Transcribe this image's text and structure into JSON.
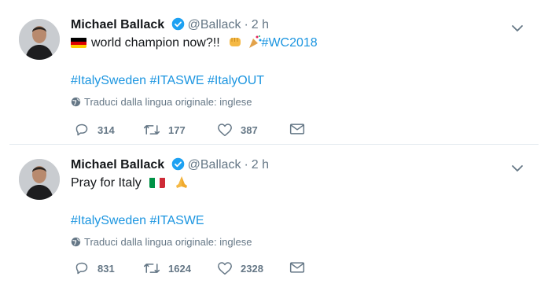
{
  "tweets": [
    {
      "name": "Michael Ballack",
      "handle": "@Ballack",
      "dot": "·",
      "time": "2 h",
      "text": "world champion now?!!",
      "tags": "#ItalySweden #ITASWE #ItalyOUT",
      "inline_tag": "#WC2018",
      "translate": "Traduci dalla lingua originale: inglese",
      "replies": "314",
      "retweets": "177",
      "likes": "387"
    },
    {
      "name": "Michael Ballack",
      "handle": "@Ballack",
      "dot": "·",
      "time": "2 h",
      "text": "Pray for Italy",
      "tags": "#ItalySweden #ITASWE",
      "translate": "Traduci dalla lingua originale: inglese",
      "replies": "831",
      "retweets": "1624",
      "likes": "2328"
    }
  ],
  "colors": {
    "link": "#1b95e0",
    "muted": "#657786",
    "verified": "#1da1f2",
    "divider": "#e6ecf0"
  }
}
